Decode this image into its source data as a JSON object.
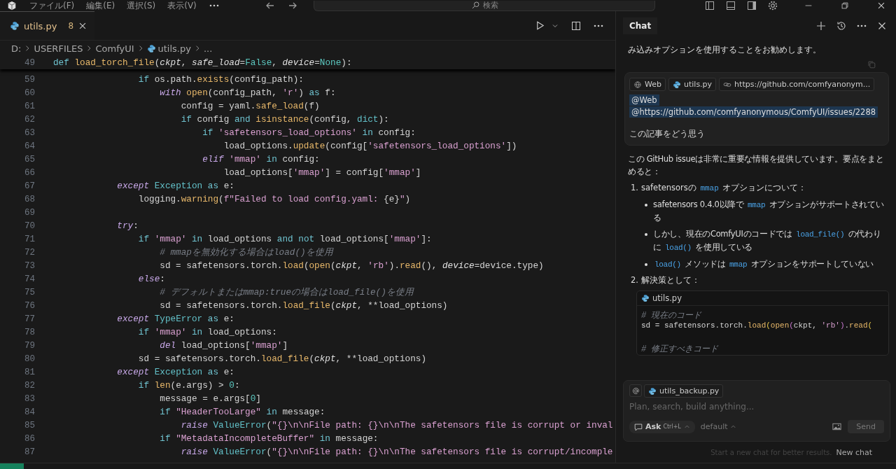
{
  "title_bar": {
    "menus": [
      "ファイル(F)",
      "編集(E)",
      "選択(S)",
      "表示(V)"
    ],
    "search": {
      "placeholder": "検索"
    }
  },
  "editor": {
    "tabs": [
      {
        "label": "utils.py",
        "badge": "8",
        "selected": true
      }
    ],
    "breadcrumb": [
      "D:",
      "USERFILES",
      "ComfyUI",
      "utils.py",
      "..."
    ],
    "sticky_line": {
      "num": "49",
      "code": [
        {
          "kind": "kw",
          "text": "def "
        },
        {
          "kind": "fn",
          "text": "load_torch_file"
        },
        {
          "kind": "plain",
          "text": "("
        },
        {
          "kind": "param",
          "text": "ckpt"
        },
        {
          "kind": "plain",
          "text": ", "
        },
        {
          "kind": "param",
          "text": "safe_load"
        },
        {
          "kind": "plain",
          "text": "="
        },
        {
          "kind": "const",
          "text": "False"
        },
        {
          "kind": "plain",
          "text": ", "
        },
        {
          "kind": "param",
          "text": "device"
        },
        {
          "kind": "plain",
          "text": "="
        },
        {
          "kind": "const",
          "text": "None"
        },
        {
          "kind": "plain",
          "text": "):"
        }
      ]
    },
    "lines": [
      {
        "num": "59",
        "code": [
          {
            "kind": "kw",
            "text": "                if "
          },
          {
            "kind": "plain",
            "text": "os.path."
          },
          {
            "kind": "fn",
            "text": "exists"
          },
          {
            "kind": "plain",
            "text": "(config_path):"
          }
        ]
      },
      {
        "num": "60",
        "code": [
          {
            "kind": "ctl",
            "text": "                    with "
          },
          {
            "kind": "fn",
            "text": "open"
          },
          {
            "kind": "plain",
            "text": "(config_path, "
          },
          {
            "kind": "str",
            "text": "'r'"
          },
          {
            "kind": "plain",
            "text": ") "
          },
          {
            "kind": "kw",
            "text": "as"
          },
          {
            "kind": "plain",
            "text": " f:"
          }
        ]
      },
      {
        "num": "61",
        "code": [
          {
            "kind": "plain",
            "text": "                        config = yaml."
          },
          {
            "kind": "fn",
            "text": "safe_load"
          },
          {
            "kind": "plain",
            "text": "(f)"
          }
        ]
      },
      {
        "num": "62",
        "code": [
          {
            "kind": "kw",
            "text": "                        if "
          },
          {
            "kind": "plain",
            "text": "config "
          },
          {
            "kind": "kw",
            "text": "and "
          },
          {
            "kind": "fn",
            "text": "isinstance"
          },
          {
            "kind": "plain",
            "text": "(config, "
          },
          {
            "kind": "cls",
            "text": "dict"
          },
          {
            "kind": "plain",
            "text": "):"
          }
        ]
      },
      {
        "num": "63",
        "code": [
          {
            "kind": "kw",
            "text": "                            if "
          },
          {
            "kind": "str",
            "text": "'safetensors_load_options'"
          },
          {
            "kind": "kw",
            "text": " in "
          },
          {
            "kind": "plain",
            "text": "config:"
          }
        ]
      },
      {
        "num": "64",
        "code": [
          {
            "kind": "plain",
            "text": "                                load_options."
          },
          {
            "kind": "fn",
            "text": "update"
          },
          {
            "kind": "plain",
            "text": "(config["
          },
          {
            "kind": "str",
            "text": "'safetensors_load_options'"
          },
          {
            "kind": "plain",
            "text": "])"
          }
        ]
      },
      {
        "num": "65",
        "code": [
          {
            "kind": "ctl",
            "text": "                            elif "
          },
          {
            "kind": "str",
            "text": "'mmap'"
          },
          {
            "kind": "kw",
            "text": " in "
          },
          {
            "kind": "plain",
            "text": "config:"
          }
        ]
      },
      {
        "num": "66",
        "code": [
          {
            "kind": "plain",
            "text": "                                load_options["
          },
          {
            "kind": "str",
            "text": "'mmap'"
          },
          {
            "kind": "plain",
            "text": "] = config["
          },
          {
            "kind": "str",
            "text": "'mmap'"
          },
          {
            "kind": "plain",
            "text": "]"
          }
        ]
      },
      {
        "num": "67",
        "code": [
          {
            "kind": "ctl",
            "text": "            except "
          },
          {
            "kind": "cls",
            "text": "Exception "
          },
          {
            "kind": "kw",
            "text": "as "
          },
          {
            "kind": "plain",
            "text": "e:"
          }
        ]
      },
      {
        "num": "68",
        "code": [
          {
            "kind": "plain",
            "text": "                logging."
          },
          {
            "kind": "fn",
            "text": "warning"
          },
          {
            "kind": "plain",
            "text": "("
          },
          {
            "kind": "str",
            "text": "f\"Failed to load config.yaml: "
          },
          {
            "kind": "plain",
            "text": "{e}"
          },
          {
            "kind": "str",
            "text": "\""
          },
          {
            "kind": "plain",
            "text": ")"
          }
        ]
      },
      {
        "num": "69"
      },
      {
        "num": "70",
        "code": [
          {
            "kind": "ctl",
            "text": "            try"
          },
          {
            "kind": "plain",
            "text": ":"
          }
        ]
      },
      {
        "num": "71",
        "code": [
          {
            "kind": "kw",
            "text": "                if "
          },
          {
            "kind": "str",
            "text": "'mmap'"
          },
          {
            "kind": "kw",
            "text": " in "
          },
          {
            "kind": "plain",
            "text": "load_options "
          },
          {
            "kind": "kw",
            "text": "and not "
          },
          {
            "kind": "plain",
            "text": "load_options["
          },
          {
            "kind": "str",
            "text": "'mmap'"
          },
          {
            "kind": "plain",
            "text": "]:"
          }
        ]
      },
      {
        "num": "72",
        "code": [
          {
            "kind": "cmt",
            "text": "                    # mmapを無効化する場合はload()を使用"
          }
        ]
      },
      {
        "num": "73",
        "code": [
          {
            "kind": "plain",
            "text": "                    sd = safetensors.torch."
          },
          {
            "kind": "fn",
            "text": "load"
          },
          {
            "kind": "plain",
            "text": "("
          },
          {
            "kind": "fn",
            "text": "open"
          },
          {
            "kind": "plain",
            "text": "("
          },
          {
            "kind": "param",
            "text": "ckpt"
          },
          {
            "kind": "plain",
            "text": ", "
          },
          {
            "kind": "str",
            "text": "'rb'"
          },
          {
            "kind": "plain",
            "text": ")."
          },
          {
            "kind": "fn",
            "text": "read"
          },
          {
            "kind": "plain",
            "text": "(), "
          },
          {
            "kind": "param",
            "text": "device"
          },
          {
            "kind": "plain",
            "text": "=device.type)"
          }
        ]
      },
      {
        "num": "74",
        "code": [
          {
            "kind": "ctl",
            "text": "                else"
          },
          {
            "kind": "plain",
            "text": ":"
          }
        ]
      },
      {
        "num": "75",
        "code": [
          {
            "kind": "cmt",
            "text": "                    # デフォルトまたはmmap:trueの場合はload_file()を使用"
          }
        ]
      },
      {
        "num": "76",
        "code": [
          {
            "kind": "plain",
            "text": "                    sd = safetensors.torch."
          },
          {
            "kind": "fn",
            "text": "load_file"
          },
          {
            "kind": "plain",
            "text": "("
          },
          {
            "kind": "param",
            "text": "ckpt"
          },
          {
            "kind": "plain",
            "text": ", **load_options)"
          }
        ]
      },
      {
        "num": "77",
        "code": [
          {
            "kind": "ctl",
            "text": "            except "
          },
          {
            "kind": "cls",
            "text": "TypeError "
          },
          {
            "kind": "kw",
            "text": "as "
          },
          {
            "kind": "plain",
            "text": "e:"
          }
        ]
      },
      {
        "num": "78",
        "code": [
          {
            "kind": "kw",
            "text": "                if "
          },
          {
            "kind": "str",
            "text": "'mmap'"
          },
          {
            "kind": "kw",
            "text": " in "
          },
          {
            "kind": "plain",
            "text": "load_options:"
          }
        ]
      },
      {
        "num": "79",
        "code": [
          {
            "kind": "ctl",
            "text": "                    del "
          },
          {
            "kind": "plain",
            "text": "load_options["
          },
          {
            "kind": "str",
            "text": "'mmap'"
          },
          {
            "kind": "plain",
            "text": "]"
          }
        ]
      },
      {
        "num": "80",
        "code": [
          {
            "kind": "plain",
            "text": "                sd = safetensors.torch."
          },
          {
            "kind": "fn",
            "text": "load_file"
          },
          {
            "kind": "plain",
            "text": "("
          },
          {
            "kind": "param",
            "text": "ckpt"
          },
          {
            "kind": "plain",
            "text": ", **load_options)"
          }
        ]
      },
      {
        "num": "81",
        "code": [
          {
            "kind": "ctl",
            "text": "            except "
          },
          {
            "kind": "cls",
            "text": "Exception "
          },
          {
            "kind": "kw",
            "text": "as "
          },
          {
            "kind": "plain",
            "text": "e:"
          }
        ]
      },
      {
        "num": "82",
        "code": [
          {
            "kind": "kw",
            "text": "                if "
          },
          {
            "kind": "fn",
            "text": "len"
          },
          {
            "kind": "plain",
            "text": "(e.args) > "
          },
          {
            "kind": "const",
            "text": "0"
          },
          {
            "kind": "plain",
            "text": ":"
          }
        ]
      },
      {
        "num": "83",
        "code": [
          {
            "kind": "plain",
            "text": "                    message = e.args["
          },
          {
            "kind": "const",
            "text": "0"
          },
          {
            "kind": "plain",
            "text": "]"
          }
        ]
      },
      {
        "num": "84",
        "code": [
          {
            "kind": "kw",
            "text": "                    if "
          },
          {
            "kind": "str",
            "text": "\"HeaderTooLarge\""
          },
          {
            "kind": "kw",
            "text": " in "
          },
          {
            "kind": "plain",
            "text": "message:"
          }
        ]
      },
      {
        "num": "85",
        "code": [
          {
            "kind": "ctl",
            "text": "                        raise "
          },
          {
            "kind": "cls",
            "text": "ValueError"
          },
          {
            "kind": "plain",
            "text": "("
          },
          {
            "kind": "str",
            "text": "\"{}\\n\\nFile path: {}\\n\\nThe safetensors file is corrupt or inval"
          }
        ]
      },
      {
        "num": "86",
        "code": [
          {
            "kind": "kw",
            "text": "                    if "
          },
          {
            "kind": "str",
            "text": "\"MetadataIncompleteBuffer\""
          },
          {
            "kind": "kw",
            "text": " in "
          },
          {
            "kind": "plain",
            "text": "message:"
          }
        ]
      },
      {
        "num": "87",
        "code": [
          {
            "kind": "ctl",
            "text": "                        raise "
          },
          {
            "kind": "cls",
            "text": "ValueError"
          },
          {
            "kind": "plain",
            "text": "("
          },
          {
            "kind": "str",
            "text": "\"{}\\n\\nFile path: {}\\n\\nThe safetensors file is corrupt/incomple"
          }
        ]
      }
    ]
  },
  "chat": {
    "title": "Chat",
    "earlier_text": "み込みオプションを使用することをお勧めします。",
    "user_message": {
      "chips": [
        {
          "kind": "web",
          "label": "Web"
        },
        {
          "kind": "file",
          "label": "utils.py"
        },
        {
          "kind": "link",
          "label": "https://github.com/comfyanonym..."
        }
      ],
      "mentions": [
        "@Web",
        "@https://github.com/comfyanonymous/ComfyUI/issues/2288"
      ],
      "text": "この記事をどう思う"
    },
    "response": {
      "intro": "この GitHub issueは非常に重要な情報を提供しています。要点をまとめると：",
      "items": [
        {
          "number": "1.",
          "title": [
            {
              "kind": "text",
              "text": "safetensorsの "
            },
            {
              "kind": "code",
              "text": "mmap"
            },
            {
              "kind": "text",
              "text": " オプションについて："
            }
          ],
          "bullets": [
            [
              {
                "kind": "text",
                "text": "safetensors 0.4.0以降で "
              },
              {
                "kind": "code",
                "text": "mmap"
              },
              {
                "kind": "text",
                "text": " オプションがサポートされている"
              }
            ],
            [
              {
                "kind": "text",
                "text": "しかし、現在のComfyUIのコードでは "
              },
              {
                "kind": "code",
                "text": "load_file()"
              },
              {
                "kind": "text",
                "text": " の代わりに "
              },
              {
                "kind": "code",
                "text": "load()"
              },
              {
                "kind": "text",
                "text": " を使用している"
              }
            ],
            [
              {
                "kind": "code",
                "text": "load()"
              },
              {
                "kind": "text",
                "text": " メソッドは "
              },
              {
                "kind": "code",
                "text": "mmap"
              },
              {
                "kind": "text",
                "text": " オプションをサポートしていない"
              }
            ]
          ]
        },
        {
          "number": "2.",
          "title": [
            {
              "kind": "text",
              "text": "解決策として："
            }
          ],
          "code_block": {
            "file": "utils.py",
            "lines": [
              {
                "code": [
                  {
                    "kind": "cmt",
                    "text": "# 現在のコード"
                  }
                ]
              },
              {
                "code": [
                  {
                    "kind": "plain",
                    "text": "sd = safetensors.torch."
                  },
                  {
                    "kind": "fn",
                    "text": "load"
                  },
                  {
                    "kind": "br1",
                    "text": "("
                  },
                  {
                    "kind": "fn",
                    "text": "open"
                  },
                  {
                    "kind": "br2",
                    "text": "("
                  },
                  {
                    "kind": "plain",
                    "text": "ckpt, "
                  },
                  {
                    "kind": "str",
                    "text": "'rb'"
                  },
                  {
                    "kind": "br2",
                    "text": ")"
                  },
                  {
                    "kind": "plain",
                    "text": "."
                  },
                  {
                    "kind": "fn",
                    "text": "read"
                  },
                  {
                    "kind": "br1",
                    "text": "("
                  }
                ]
              },
              {
                "code": [
                  {
                    "kind": "cmt",
                    "text": "# 修正すべきコード"
                  }
                ]
              }
            ]
          }
        }
      ]
    },
    "input": {
      "chip": "utils_backup.py",
      "placeholder": "Plan, search, build anything...",
      "mode": "Ask",
      "shortcut": "Ctrl+L",
      "model": "default",
      "send": {
        "label": "Send",
        "disabled": true
      }
    },
    "hint": "Start a new chat for better results.",
    "new_chat": "New chat"
  }
}
